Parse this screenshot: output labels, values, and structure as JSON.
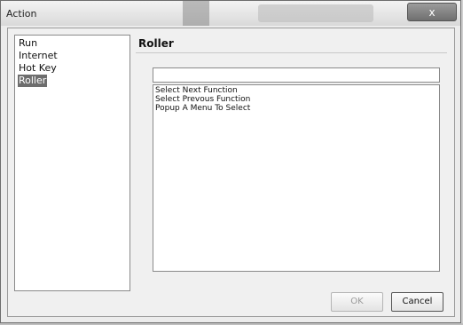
{
  "window": {
    "title": "Action",
    "close_glyph": "x"
  },
  "categories": [
    {
      "label": "Run",
      "selected": false
    },
    {
      "label": "Internet",
      "selected": false
    },
    {
      "label": "Hot Key",
      "selected": false
    },
    {
      "label": "Roller",
      "selected": true
    }
  ],
  "panel": {
    "title": "Roller",
    "input_value": "",
    "functions": [
      "Select Next Function",
      "Select Prevous Function",
      "Popup A Menu To Select"
    ]
  },
  "buttons": {
    "ok": "OK",
    "cancel": "Cancel"
  }
}
